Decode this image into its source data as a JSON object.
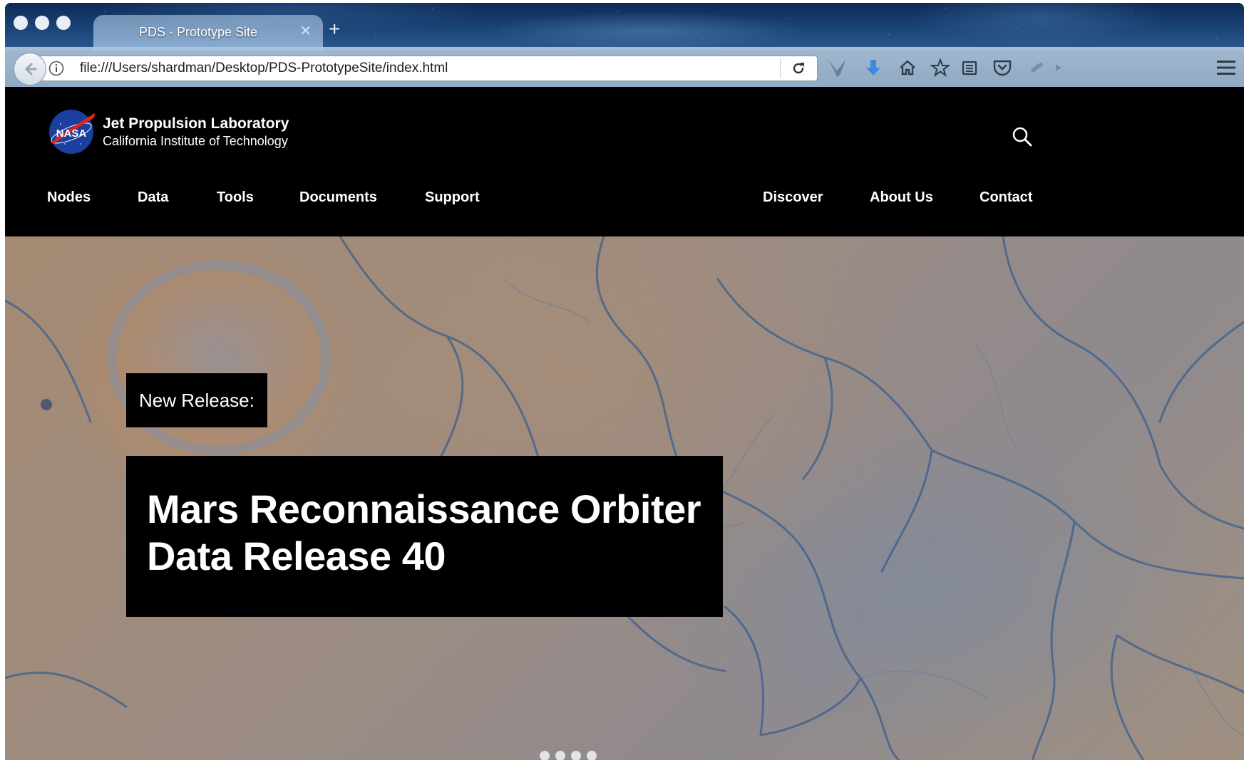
{
  "browser": {
    "tab_title": "PDS - Prototype Site",
    "tab_close_icon": "close-icon",
    "new_tab_label": "+",
    "url": "file:///Users/shardman/Desktop/PDS-PrototypeSite/index.html",
    "toolbar_icons": [
      "bird-icon",
      "download-icon",
      "home-icon",
      "bookmark-star-icon",
      "reading-list-icon",
      "pocket-icon",
      "extension-icon",
      "menu-icon"
    ]
  },
  "site": {
    "org_name": "Jet Propulsion Laboratory",
    "org_subtitle": "California Institute of Technology",
    "logo_text": "NASA",
    "nav_left": [
      "Nodes",
      "Data",
      "Tools",
      "Documents",
      "Support"
    ],
    "nav_right": [
      "Discover",
      "About Us",
      "Contact"
    ]
  },
  "hero": {
    "label": "New Release:",
    "headline": "Mars Reconnaissance Orbiter Data Release 40"
  },
  "colors": {
    "header_bg": "#000000",
    "text": "#ffffff",
    "chrome_sky": "#1b4478"
  }
}
